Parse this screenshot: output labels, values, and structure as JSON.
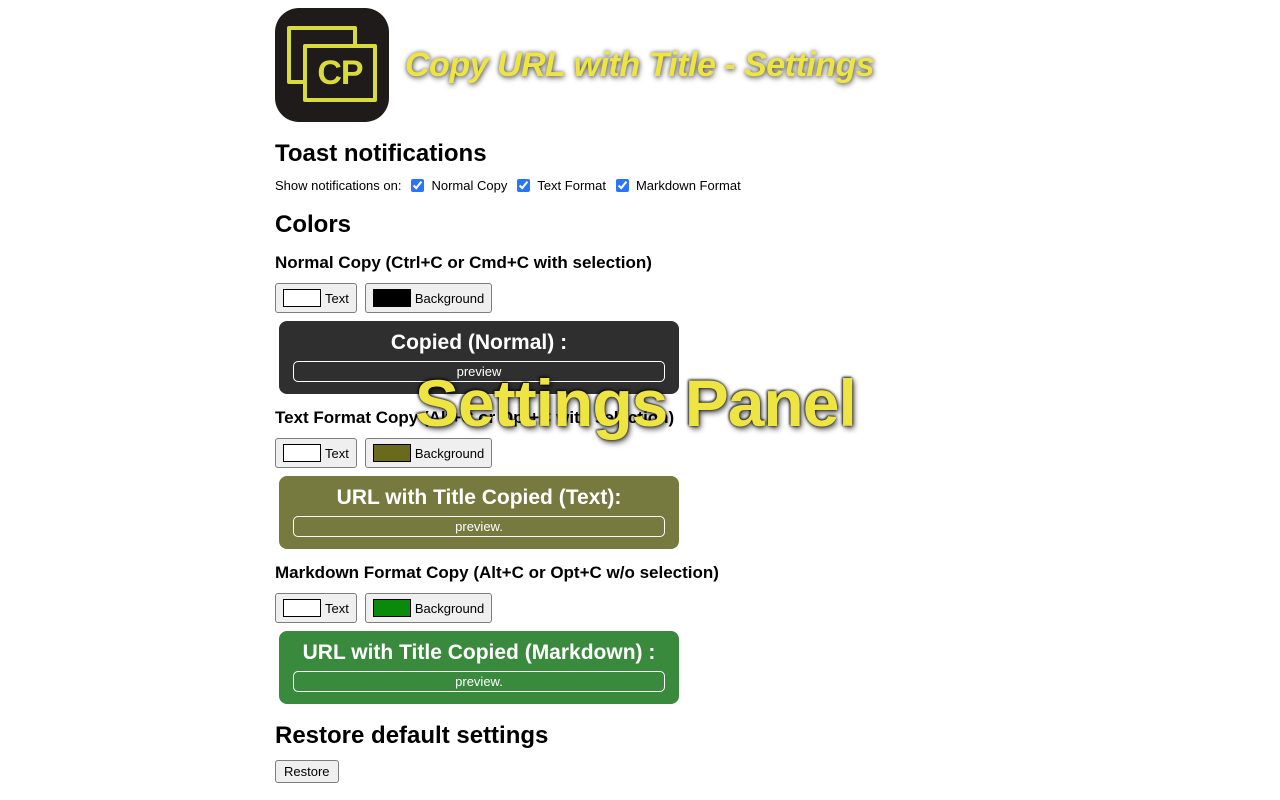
{
  "logo_text": "CP",
  "page_title": "Copy URL with Title - Settings",
  "overlay_label": "Settings Panel",
  "sections": {
    "toast": {
      "heading": "Toast notifications",
      "label": "Show notifications on:",
      "options": [
        {
          "label": "Normal Copy",
          "checked": true
        },
        {
          "label": "Text Format",
          "checked": true
        },
        {
          "label": "Markdown Format",
          "checked": true
        }
      ]
    },
    "colors": {
      "heading": "Colors",
      "groups": [
        {
          "title": "Normal Copy (Ctrl+C or Cmd+C with selection)",
          "text_label": "Text",
          "bg_label": "Background",
          "text_color": "#ffffff",
          "bg_color": "#000000",
          "toast_bg": "#2f2f2f",
          "toast_fg": "#ffffff",
          "toast_title": "Copied (Normal) :",
          "toast_preview": "preview"
        },
        {
          "title": "Text Format Copy (Alt+C or Opt+C with selection)",
          "text_label": "Text",
          "bg_label": "Background",
          "text_color": "#ffffff",
          "bg_color": "#6a6a1a",
          "toast_bg": "#767a3e",
          "toast_fg": "#ffffff",
          "toast_title": "URL with Title Copied (Text):",
          "toast_preview": "preview."
        },
        {
          "title": "Markdown Format Copy (Alt+C or Opt+C w/o selection)",
          "text_label": "Text",
          "bg_label": "Background",
          "text_color": "#ffffff",
          "bg_color": "#0a8a0a",
          "toast_bg": "#3a8a3d",
          "toast_fg": "#ffffff",
          "toast_title": "URL with Title Copied (Markdown) :",
          "toast_preview": "preview."
        }
      ]
    },
    "restore": {
      "heading": "Restore default settings",
      "button": "Restore"
    }
  }
}
